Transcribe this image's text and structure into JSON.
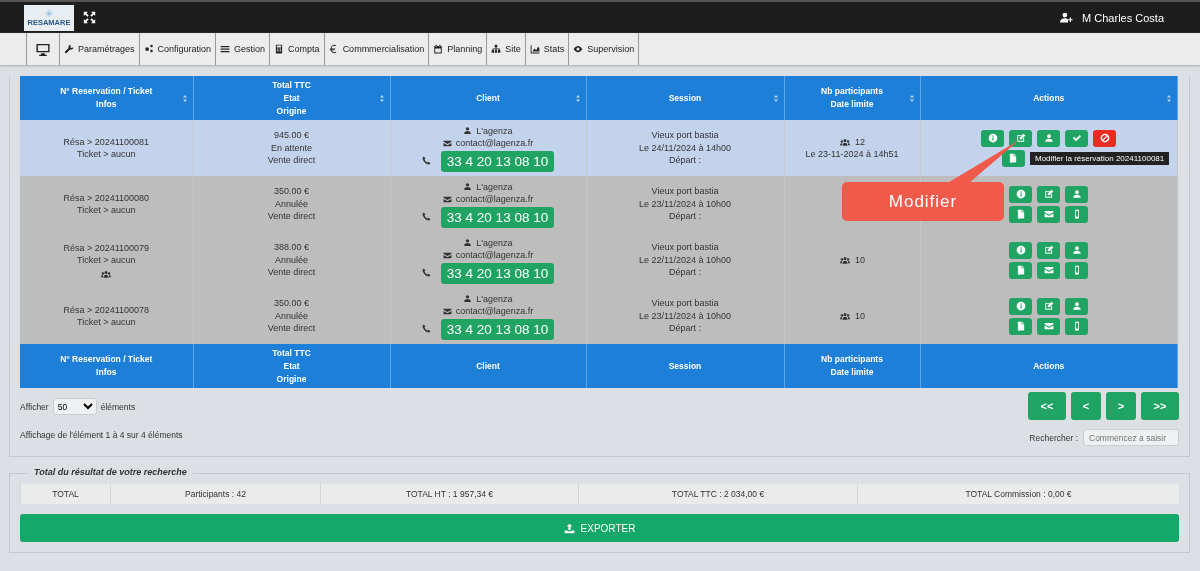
{
  "header": {
    "logo": "RESAMARE",
    "user": "M Charles Costa"
  },
  "nav": [
    {
      "kind": "monitor"
    },
    {
      "kind": "wrench",
      "label": "Paramétrages"
    },
    {
      "kind": "gears",
      "label": "Configuration"
    },
    {
      "kind": "list",
      "label": "Gestion"
    },
    {
      "kind": "calc",
      "label": "Compta"
    },
    {
      "kind": "euro",
      "label": "Commmercialisation"
    },
    {
      "kind": "calendar",
      "label": "Planning"
    },
    {
      "kind": "sitemap",
      "label": "Site"
    },
    {
      "kind": "chart",
      "label": "Stats"
    },
    {
      "kind": "eye",
      "label": "Supervision"
    }
  ],
  "table": {
    "columns": [
      [
        "N° Reservation / Ticket",
        "Infos"
      ],
      [
        "Total TTC",
        "Etat",
        "Origine"
      ],
      [
        "Client"
      ],
      [
        "Session"
      ],
      [
        "Nb participants",
        "Date limite"
      ],
      [
        "Actions"
      ]
    ],
    "rows": [
      {
        "selected": true,
        "resa": "Résa > 20241100081",
        "ticket": "Ticket > aucun",
        "group": false,
        "total": "945.00 €",
        "etat": "En attente",
        "origine": "Vente direct",
        "client": "L'agenza",
        "email": "contact@lagenza.fr",
        "phone": "33 4 20 13 08 10",
        "session": "Vieux port bastia",
        "date": "Le 24/11/2024 à 14h00",
        "depart": "Départ :",
        "participants": "12",
        "date_limite": "Le 23-11-2024 à 14h51",
        "actions": [
          [
            {
              "kind": "info"
            },
            {
              "kind": "edit"
            },
            {
              "kind": "user"
            },
            {
              "kind": "check"
            },
            {
              "kind": "cancel"
            }
          ],
          [
            {
              "kind": "doc"
            }
          ]
        ]
      },
      {
        "selected": false,
        "resa": "Résa > 20241100080",
        "ticket": "Ticket > aucun",
        "group": false,
        "total": "350.00 €",
        "etat": "Annulée",
        "origine": "Vente direct",
        "client": "L'agenza",
        "email": "contact@lagenza.fr",
        "phone": "33 4 20 13 08 10",
        "session": "Vieux port bastia",
        "date": "Le 23/11/2024 à 10h00",
        "depart": "Départ :",
        "actions": [
          [
            {
              "kind": "info"
            },
            {
              "kind": "edit"
            },
            {
              "kind": "user"
            }
          ],
          [
            {
              "kind": "doc"
            },
            {
              "kind": "mail"
            },
            {
              "kind": "mobile"
            }
          ]
        ]
      },
      {
        "selected": false,
        "resa": "Résa > 20241100079",
        "ticket": "Ticket > aucun",
        "group": true,
        "total": "388.00 €",
        "etat": "Annulée",
        "origine": "Vente direct",
        "client": "L'agenza",
        "email": "contact@lagenza.fr",
        "phone": "33 4 20 13 08 10",
        "session": "Vieux port bastia",
        "date": "Le 22/11/2024 à 10h00",
        "depart": "Départ :",
        "participants": "10",
        "actions": [
          [
            {
              "kind": "info"
            },
            {
              "kind": "edit"
            },
            {
              "kind": "user"
            }
          ],
          [
            {
              "kind": "doc"
            },
            {
              "kind": "mail"
            },
            {
              "kind": "mobile"
            }
          ]
        ]
      },
      {
        "selected": false,
        "resa": "Résa > 20241100078",
        "ticket": "Ticket > aucun",
        "group": false,
        "total": "350.00 €",
        "etat": "Annulée",
        "origine": "Vente direct",
        "client": "L'agenza",
        "email": "contact@lagenza.fr",
        "phone": "33 4 20 13 08 10",
        "session": "Vieux port bastia",
        "date": "Le 23/11/2024 à 10h00",
        "depart": "Départ :",
        "participants": "10",
        "actions": [
          [
            {
              "kind": "info"
            },
            {
              "kind": "edit"
            },
            {
              "kind": "user"
            }
          ],
          [
            {
              "kind": "doc"
            },
            {
              "kind": "mail"
            },
            {
              "kind": "mobile"
            }
          ]
        ]
      }
    ],
    "footer_columns": [
      [
        "N° Reservation / Ticket",
        "Infos"
      ],
      [
        "Total TTC",
        "Etat",
        "Origine"
      ],
      [
        "Client"
      ],
      [
        "Session"
      ],
      [
        "Nb participants",
        "Date limite"
      ],
      [
        "Actions"
      ]
    ]
  },
  "tooltip": "Modifier la réservation 20241100081",
  "callout": "Modifier",
  "length": {
    "label": "Afficher",
    "value": "50",
    "suffix": "éléments"
  },
  "pagination": [
    "<<",
    "<",
    ">",
    ">>"
  ],
  "info": "Affichage de l'élément 1 à 4 sur 4 éléments",
  "search": {
    "label": "Rechercher :",
    "placeholder": "Commencez a saisir"
  },
  "totals": {
    "legend": "Total du résultat de votre recherche",
    "cells": [
      "TOTAL",
      "Participants : 42",
      "TOTAL HT : 1 957,34 €",
      "TOTAL TTC : 2 034,00 €",
      "TOTAL Commission : 0,00 €"
    ]
  },
  "export": "EXPORTER"
}
